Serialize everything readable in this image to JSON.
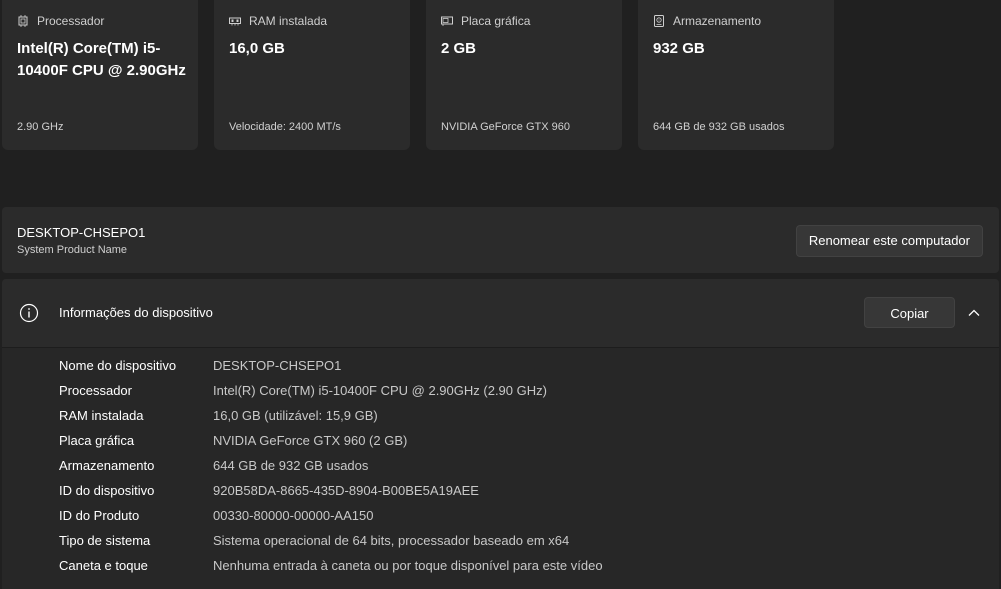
{
  "cards": [
    {
      "label": "Processador",
      "icon": "processor-icon",
      "value": "Intel(R) Core(TM) i5-10400F CPU @ 2.90GHz",
      "sub": "2.90 GHz"
    },
    {
      "label": "RAM instalada",
      "icon": "ram-icon",
      "value": "16,0 GB",
      "sub": "Velocidade: 2400 MT/s"
    },
    {
      "label": "Placa gráfica",
      "icon": "graphics-card-icon",
      "value": "2 GB",
      "sub": "NVIDIA GeForce GTX 960"
    },
    {
      "label": "Armazenamento",
      "icon": "storage-icon",
      "value": "932 GB",
      "sub": "644 GB de 932 GB usados"
    }
  ],
  "rename": {
    "pc_name": "DESKTOP-CHSEPO1",
    "model": "System Product Name",
    "button_label": "Renomear este computador"
  },
  "device_info": {
    "title": "Informações do dispositivo",
    "copy_label": "Copiar",
    "rows": [
      {
        "key": "Nome do dispositivo",
        "value": "DESKTOP-CHSEPO1"
      },
      {
        "key": "Processador",
        "value": "Intel(R) Core(TM) i5-10400F CPU @ 2.90GHz (2.90 GHz)"
      },
      {
        "key": "RAM instalada",
        "value": "16,0 GB (utilizável: 15,9 GB)"
      },
      {
        "key": "Placa gráfica",
        "value": "NVIDIA GeForce GTX 960 (2 GB)"
      },
      {
        "key": "Armazenamento",
        "value": "644 GB de 932 GB usados"
      },
      {
        "key": "ID do dispositivo",
        "value": "920B58DA-8665-435D-8904-B00BE5A19AEE"
      },
      {
        "key": "ID do Produto",
        "value": "00330-80000-00000-AA150"
      },
      {
        "key": "Tipo de sistema",
        "value": "Sistema operacional de 64 bits, processador baseado em x64"
      },
      {
        "key": "Caneta e toque",
        "value": "Nenhuma entrada à caneta ou por toque disponível para este vídeo"
      }
    ]
  },
  "colors": {
    "background": "#202020",
    "card": "#2b2b2b",
    "button": "#373737"
  }
}
